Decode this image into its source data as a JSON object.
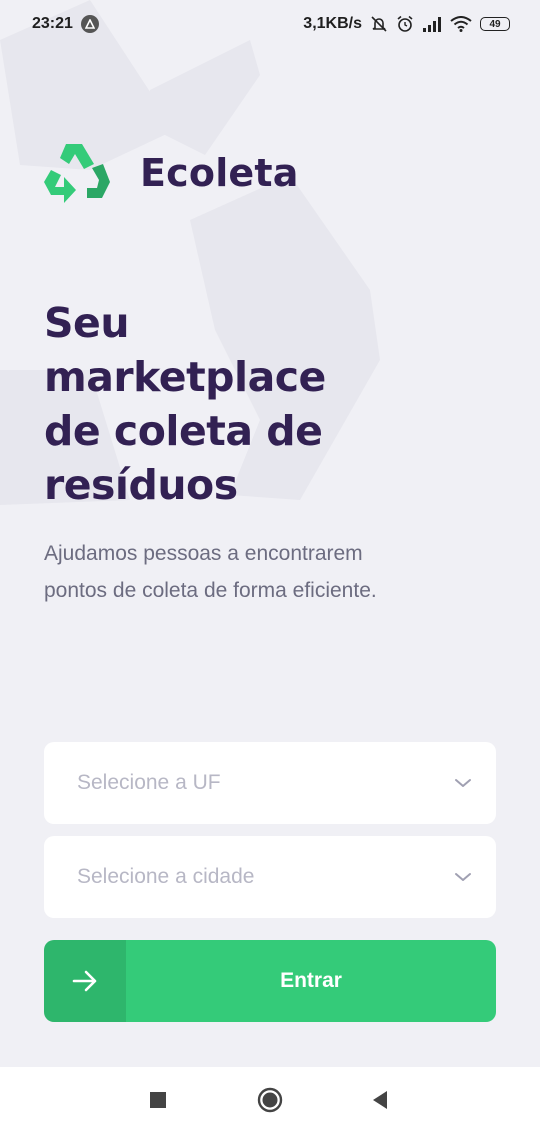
{
  "status_bar": {
    "time": "23:21",
    "network_speed": "3,1KB/s",
    "battery_level": "49",
    "icons": [
      "app-notification-icon",
      "mute-icon",
      "alarm-icon",
      "signal-icon",
      "wifi-icon",
      "battery-icon"
    ]
  },
  "brand": {
    "name": "Ecoleta",
    "logo_icon": "recycle-icon",
    "colors": {
      "green": "#34CB79",
      "dark_green": "#2BA765",
      "purple": "#322153"
    }
  },
  "main": {
    "title": "Seu marketplace de coleta de resíduos",
    "description": "Ajudamos pessoas a encontrarem pontos de coleta de forma eficiente."
  },
  "form": {
    "uf_select": {
      "placeholder": "Selecione a UF",
      "icon": "chevron-down-icon"
    },
    "city_select": {
      "placeholder": "Selecione a cidade",
      "icon": "chevron-down-icon"
    },
    "enter_button": {
      "label": "Entrar",
      "icon": "arrow-right-icon",
      "color": "#34CB79"
    }
  },
  "nav_bar": {
    "buttons": [
      "recents-button",
      "home-button",
      "back-button"
    ]
  }
}
